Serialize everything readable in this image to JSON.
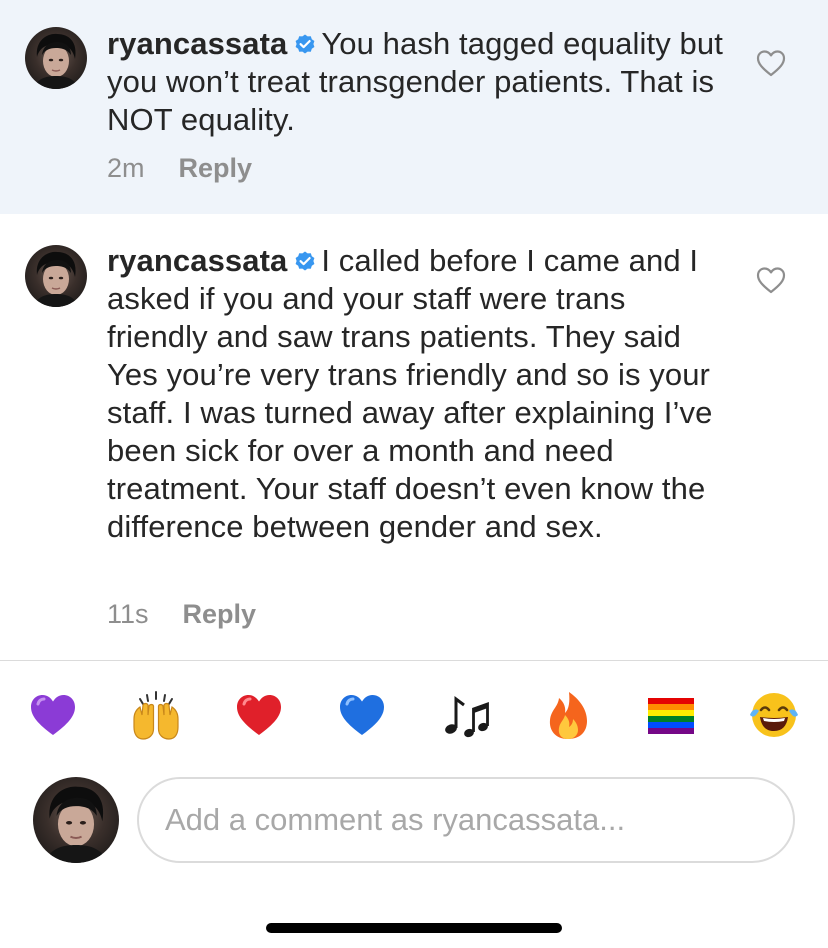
{
  "comments": [
    {
      "username": "ryancassata",
      "text": "You hash tagged equality but you won’t treat transgender patients. That is NOT equality.",
      "time": "2m",
      "reply_label": "Reply"
    },
    {
      "username": "ryancassata",
      "text": "I called before I came and I asked if you and your staff were trans friendly and saw trans patients. They said Yes you’re very trans friendly and so is your staff. I was turned away after explaining I’ve been sick for over a month and need treatment. Your staff doesn’t even know the difference between gender and sex.",
      "time": "11s",
      "reply_label": "Reply"
    }
  ],
  "emoji_bar": [
    {
      "icon": "purple-heart-icon",
      "glyph": "💜",
      "color": "#8b3bd6"
    },
    {
      "icon": "raising-hands-icon",
      "glyph": "🙌",
      "color": "#f5b82e"
    },
    {
      "icon": "red-heart-icon",
      "glyph": "❤️",
      "color": "#e0202a"
    },
    {
      "icon": "blue-heart-icon",
      "glyph": "💙",
      "color": "#1f6fe0"
    },
    {
      "icon": "musical-notes-icon",
      "glyph": "🎶",
      "color": "#1a1a1a"
    },
    {
      "icon": "fire-icon",
      "glyph": "🔥",
      "color": "#f5651d"
    },
    {
      "icon": "rainbow-flag-icon",
      "glyph": "🏳️‍🌈",
      "color": "#e40303"
    },
    {
      "icon": "tears-of-joy-icon",
      "glyph": "😂",
      "color": "#f8c21b"
    }
  ],
  "composer": {
    "placeholder": "Add a comment as ryancassata..."
  },
  "colors": {
    "highlight_bg": "#eff4fa",
    "verified_blue": "#3897f0",
    "meta_gray": "#8e8e8e",
    "text": "#262626"
  }
}
